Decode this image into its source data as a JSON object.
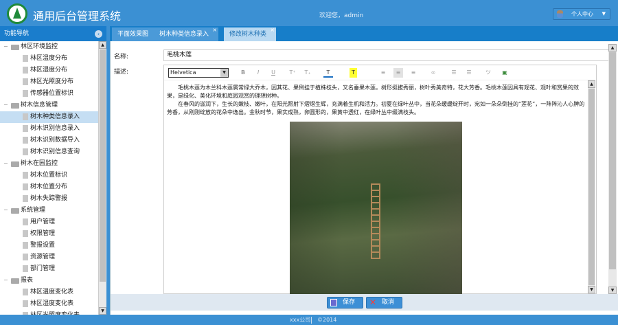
{
  "header": {
    "title": "通用后台管理系统",
    "welcome": "欢迎您，admin",
    "user_menu": "个人中心"
  },
  "sidebar": {
    "title": "功能导航",
    "tree": [
      {
        "type": "group",
        "label": "林区环境监控"
      },
      {
        "type": "leaf",
        "label": "林区温度分布"
      },
      {
        "type": "leaf",
        "label": "林区湿度分布"
      },
      {
        "type": "leaf",
        "label": "林区光照度分布"
      },
      {
        "type": "leaf",
        "label": "传感器位置标识"
      },
      {
        "type": "group",
        "label": "树木信息管理"
      },
      {
        "type": "leaf",
        "label": "树木种类信息录入",
        "selected": true
      },
      {
        "type": "leaf",
        "label": "树木识别信息录入"
      },
      {
        "type": "leaf",
        "label": "树木识别数据导入"
      },
      {
        "type": "leaf",
        "label": "树木识别信息查询"
      },
      {
        "type": "group",
        "label": "树木在园监控"
      },
      {
        "type": "leaf",
        "label": "树木位置标识"
      },
      {
        "type": "leaf",
        "label": "树木位置分布"
      },
      {
        "type": "leaf",
        "label": "树木失踪警报"
      },
      {
        "type": "group",
        "label": "系统管理"
      },
      {
        "type": "leaf",
        "label": "用户管理"
      },
      {
        "type": "leaf",
        "label": "权限管理"
      },
      {
        "type": "leaf",
        "label": "警报设置"
      },
      {
        "type": "leaf",
        "label": "资源管理"
      },
      {
        "type": "leaf",
        "label": "部门管理"
      },
      {
        "type": "group",
        "label": "报表"
      },
      {
        "type": "leaf",
        "label": "林区温度变化表"
      },
      {
        "type": "leaf",
        "label": "林区湿度变化表"
      },
      {
        "type": "leaf",
        "label": "林区光照度变化表"
      }
    ]
  },
  "tabs": [
    {
      "label": "平面效果图",
      "closable": false
    },
    {
      "label": "树木种类信息录入",
      "closable": true
    },
    {
      "label": "修改树木种类",
      "closable": true,
      "active": true
    }
  ],
  "form": {
    "name_label": "名称:",
    "name_value": "毛桃木莲",
    "desc_label": "描述:",
    "font": "Helvetica",
    "toolbar": {
      "bold": "B",
      "italic": "I",
      "underline": "U",
      "superscript": "T⁺",
      "subscript": "T₊",
      "font_color": "T",
      "highlight": "T",
      "highlight_color": "#ffff33",
      "font_color_value": "#1a6fc2"
    },
    "paragraphs": [
      "　　毛桃木莲为木兰科木莲属常绿大乔木，因其花、果倒挂于植株枝头，又名垂果木莲。树形挺拔秀丽，树叶秀美奇特，花大芳香。毛桃木莲因具有观花、观叶和赏果的效果，是绿化、美化环境和庭园观赏的理想树种。",
      "　　在春风的滋润下，生长的嫩枝、嫩叶，在阳光照射下熠熠生辉，充满着生机和活力。初夏在绿叶丛中，当花朵缓缓绽开时，宛如一朵朵倒挂的“莲花”，一阵阵沁人心脾的芳香，从刚刚绽放的花朵中逸出。金秋时节，果实成熟，卵圆形的，果黄中透红，在绿叶丛中缀满枝头。"
    ]
  },
  "buttons": {
    "save": "保存",
    "cancel": "取消"
  },
  "footer": {
    "company": "xxx公司",
    "copyright": "©2014"
  }
}
